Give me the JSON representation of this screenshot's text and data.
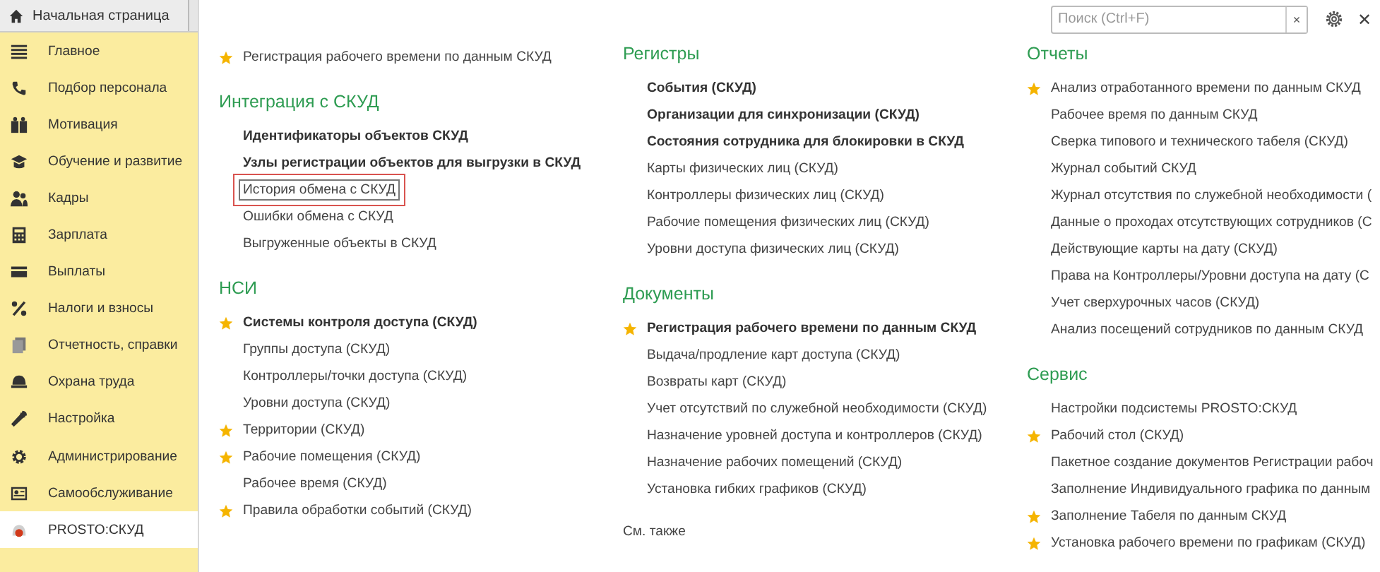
{
  "tabs": [
    {
      "label": "Начальная страница"
    }
  ],
  "sidebar": {
    "items": [
      {
        "label": "Главное",
        "selected": false
      },
      {
        "label": "Подбор персонала",
        "selected": false
      },
      {
        "label": "Мотивация",
        "selected": false
      },
      {
        "label": "Обучение и развитие",
        "selected": false
      },
      {
        "label": "Кадры",
        "selected": false
      },
      {
        "label": "Зарплата",
        "selected": false
      },
      {
        "label": "Выплаты",
        "selected": false
      },
      {
        "label": "Налоги и взносы",
        "selected": false
      },
      {
        "label": "Отчетность, справки",
        "selected": false
      },
      {
        "label": "Охрана труда",
        "selected": false
      },
      {
        "label": "Настройка",
        "selected": false
      },
      {
        "label": "Администрирование",
        "selected": false
      },
      {
        "label": "Самообслуживание",
        "selected": false
      },
      {
        "label": "PROSTO:СКУД",
        "selected": true
      }
    ]
  },
  "search": {
    "placeholder": "Поиск (Ctrl+F)",
    "clear": "×"
  },
  "close": "✕",
  "columns": [
    {
      "sections": [
        {
          "items": [
            {
              "text": "Регистрация рабочего времени по данным СКУД",
              "bold": false,
              "star": true,
              "outlined": false
            }
          ]
        },
        {
          "title": "Интеграция с СКУД",
          "items": [
            {
              "text": "Идентификаторы объектов СКУД",
              "bold": true,
              "star": false,
              "outlined": false
            },
            {
              "text": "Узлы регистрации объектов для выгрузки в СКУД",
              "bold": true,
              "star": false,
              "outlined": false
            },
            {
              "text": "История обмена с СКУД",
              "bold": false,
              "star": false,
              "outlined": true
            },
            {
              "text": "Ошибки обмена с СКУД",
              "bold": false,
              "star": false,
              "outlined": false
            },
            {
              "text": "Выгруженные объекты в СКУД",
              "bold": false,
              "star": false,
              "outlined": false
            }
          ]
        },
        {
          "title": "НСИ",
          "items": [
            {
              "text": "Системы контроля доступа (СКУД)",
              "bold": true,
              "star": true,
              "outlined": false
            },
            {
              "text": "Группы доступа (СКУД)",
              "bold": false,
              "star": false,
              "outlined": false
            },
            {
              "text": "Контроллеры/точки доступа (СКУД)",
              "bold": false,
              "star": false,
              "outlined": false
            },
            {
              "text": "Уровни доступа (СКУД)",
              "bold": false,
              "star": false,
              "outlined": false
            },
            {
              "text": "Территории (СКУД)",
              "bold": false,
              "star": true,
              "outlined": false
            },
            {
              "text": "Рабочие помещения (СКУД)",
              "bold": false,
              "star": true,
              "outlined": false
            },
            {
              "text": "Рабочее время (СКУД)",
              "bold": false,
              "star": false,
              "outlined": false
            },
            {
              "text": "Правила обработки событий (СКУД)",
              "bold": false,
              "star": true,
              "outlined": false
            }
          ]
        }
      ]
    },
    {
      "sections": [
        {
          "title": "Регистры",
          "items": [
            {
              "text": "События (СКУД)",
              "bold": true,
              "star": false,
              "outlined": false
            },
            {
              "text": "Организации для синхронизации (СКУД)",
              "bold": true,
              "star": false,
              "outlined": false
            },
            {
              "text": "Состояния сотрудника для блокировки в СКУД",
              "bold": true,
              "star": false,
              "outlined": false
            },
            {
              "text": "Карты физических лиц (СКУД)",
              "bold": false,
              "star": false,
              "outlined": false
            },
            {
              "text": "Контроллеры физических лиц (СКУД)",
              "bold": false,
              "star": false,
              "outlined": false
            },
            {
              "text": "Рабочие помещения физических лиц (СКУД)",
              "bold": false,
              "star": false,
              "outlined": false
            },
            {
              "text": "Уровни доступа физических лиц (СКУД)",
              "bold": false,
              "star": false,
              "outlined": false
            }
          ]
        },
        {
          "title": "Документы",
          "items": [
            {
              "text": "Регистрация рабочего времени по данным СКУД",
              "bold": true,
              "star": true,
              "outlined": false
            },
            {
              "text": "Выдача/продление карт доступа (СКУД)",
              "bold": false,
              "star": false,
              "outlined": false
            },
            {
              "text": "Возвраты карт (СКУД)",
              "bold": false,
              "star": false,
              "outlined": false
            },
            {
              "text": "Учет отсутствий по служебной необходимости (СКУД)",
              "bold": false,
              "star": false,
              "outlined": false
            },
            {
              "text": "Назначение уровней доступа и контроллеров (СКУД)",
              "bold": false,
              "star": false,
              "outlined": false
            },
            {
              "text": "Назначение рабочих помещений (СКУД)",
              "bold": false,
              "star": false,
              "outlined": false
            },
            {
              "text": "Установка гибких графиков (СКУД)",
              "bold": false,
              "star": false,
              "outlined": false
            }
          ]
        },
        {
          "link": "См. также"
        }
      ]
    },
    {
      "sections": [
        {
          "title": "Отчеты",
          "items": [
            {
              "text": "Анализ отработанного времени по данным СКУД",
              "bold": false,
              "star": true,
              "outlined": false
            },
            {
              "text": "Рабочее время по данным СКУД",
              "bold": false,
              "star": false,
              "outlined": false
            },
            {
              "text": "Сверка типового и технического табеля (СКУД)",
              "bold": false,
              "star": false,
              "outlined": false
            },
            {
              "text": "Журнал событий СКУД",
              "bold": false,
              "star": false,
              "outlined": false
            },
            {
              "text": "Журнал отсутствия по служебной необходимости (",
              "bold": false,
              "star": false,
              "outlined": false
            },
            {
              "text": "Данные о проходах отсутствующих сотрудников (С",
              "bold": false,
              "star": false,
              "outlined": false
            },
            {
              "text": "Действующие карты на дату (СКУД)",
              "bold": false,
              "star": false,
              "outlined": false
            },
            {
              "text": "Права на Контроллеры/Уровни доступа на дату (С",
              "bold": false,
              "star": false,
              "outlined": false
            },
            {
              "text": "Учет сверхурочных часов (СКУД)",
              "bold": false,
              "star": false,
              "outlined": false
            },
            {
              "text": "Анализ посещений сотрудников по данным СКУД",
              "bold": false,
              "star": false,
              "outlined": false
            }
          ]
        },
        {
          "title": "Сервис",
          "items": [
            {
              "text": "Настройки подсистемы PROSTO:СКУД",
              "bold": false,
              "star": false,
              "outlined": false
            },
            {
              "text": "Рабочий стол (СКУД)",
              "bold": false,
              "star": true,
              "outlined": false
            },
            {
              "text": "Пакетное создание документов Регистрации рабоч",
              "bold": false,
              "star": false,
              "outlined": false
            },
            {
              "text": "Заполнение Индивидуального графика по данным",
              "bold": false,
              "star": false,
              "outlined": false
            },
            {
              "text": "Заполнение Табеля по данным СКУД",
              "bold": false,
              "star": true,
              "outlined": false
            },
            {
              "text": "Установка рабочего времени по графикам (СКУД)",
              "bold": false,
              "star": true,
              "outlined": false
            }
          ]
        }
      ]
    }
  ]
}
